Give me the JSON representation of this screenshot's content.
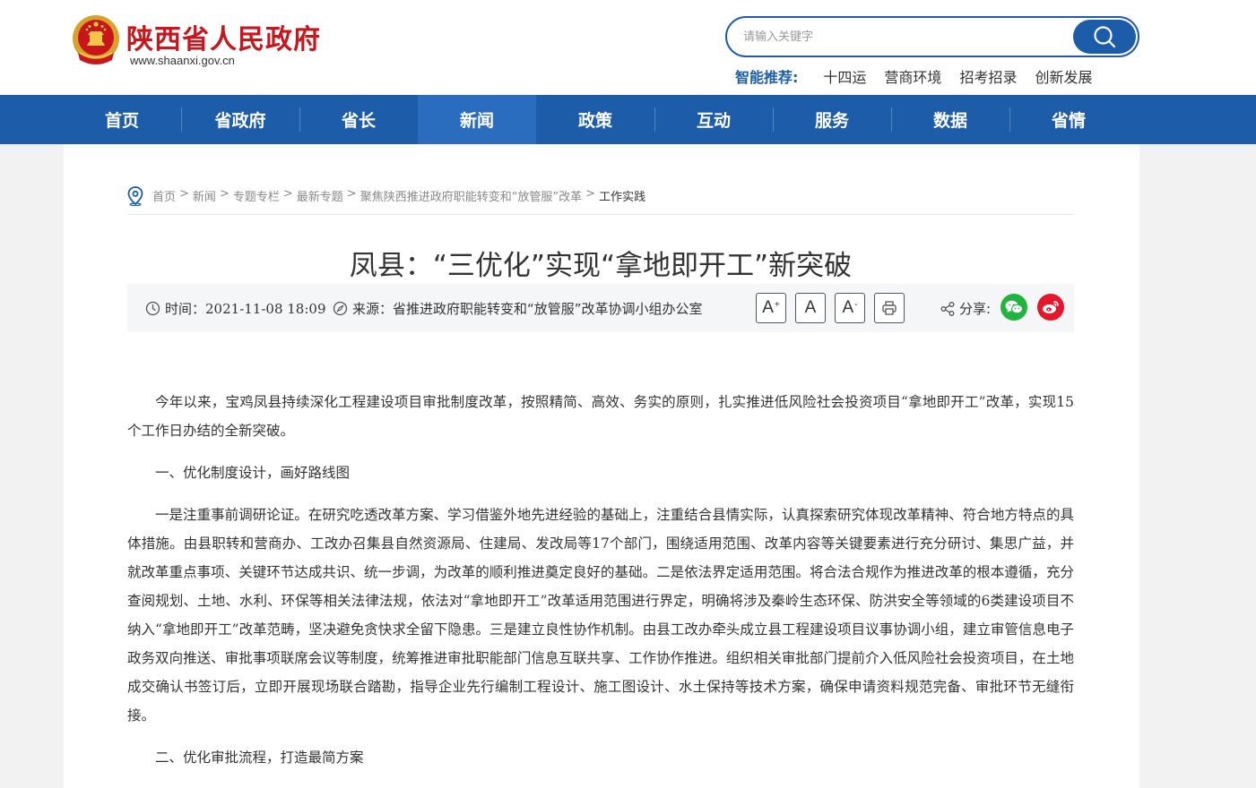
{
  "header": {
    "site_name": "陕西省人民政府",
    "site_url": "www.shaanxi.gov.cn",
    "search_placeholder": "请输入关键字",
    "smart_label": "智能推荐:",
    "smart_items": [
      "十四运",
      "营商环境",
      "招考招录",
      "创新发展"
    ]
  },
  "nav": {
    "items": [
      "首页",
      "省政府",
      "省长",
      "新闻",
      "政策",
      "互动",
      "服务",
      "数据",
      "省情"
    ],
    "active": "新闻"
  },
  "breadcrumb": [
    "首页",
    "新闻",
    "专题专栏",
    "最新专题",
    "聚焦陕西推进政府职能转变和“放管服”改革",
    "工作实践"
  ],
  "breadcrumb_sep": ">",
  "article": {
    "title": "凤县：“三优化”实现“拿地即开工”新突破",
    "time_label": "时间：",
    "time": "2021-11-08 18:09",
    "source_label": "来源：",
    "source": "省推进政府职能转变和“放管服”改革协调小组办公室",
    "font_large": "A",
    "font_normal": "A",
    "font_small": "A",
    "font_large_sup": "+",
    "font_small_sup": "-",
    "share_label": "分享:",
    "paragraphs": [
      "今年以来，宝鸡凤县持续深化工程建设项目审批制度改革，按照精简、高效、务实的原则，扎实推进低风险社会投资项目“拿地即开工”改革，实现15个工作日办结的全新突破。",
      "一、优化制度设计，画好路线图",
      "一是注重事前调研论证。在研究吃透改革方案、学习借鉴外地先进经验的基础上，注重结合县情实际，认真探索研究体现改革精神、符合地方特点的具体措施。由县职转和营商办、工改办召集县自然资源局、住建局、发改局等17个部门，围绕适用范围、改革内容等关键要素进行充分研讨、集思广益，并就改革重点事项、关键环节达成共识、统一步调，为改革的顺利推进奠定良好的基础。二是依法界定适用范围。将合法合规作为推进改革的根本遵循，充分查阅规划、土地、水利、环保等相关法律法规，依法对“拿地即开工”改革适用范围进行界定，明确将涉及秦岭生态环保、防洪安全等领域的6类建设项目不纳入“拿地即开工”改革范畴，坚决避免贪快求全留下隐患。三是建立良性协作机制。由县工改办牵头成立县工程建设项目议事协调小组，建立审管信息电子政务双向推送、审批事项联席会议等制度，统筹推进审批职能部门信息互联共享、工作协作推进。组织相关审批部门提前介入低风险社会投资项目，在土地成交确认书签订后，立即开展现场联合踏勘，指导企业先行编制工程设计、施工图设计、水土保持等技术方案，确保申请资料规范完备、审批环节无缝衔接。",
      "二、优化审批流程，打造最简方案"
    ]
  },
  "colors": {
    "brand_blue": "#1d5ca8",
    "brand_red": "#c8161d",
    "wechat_green": "#22b43c",
    "weibo_red": "#e6162d"
  }
}
